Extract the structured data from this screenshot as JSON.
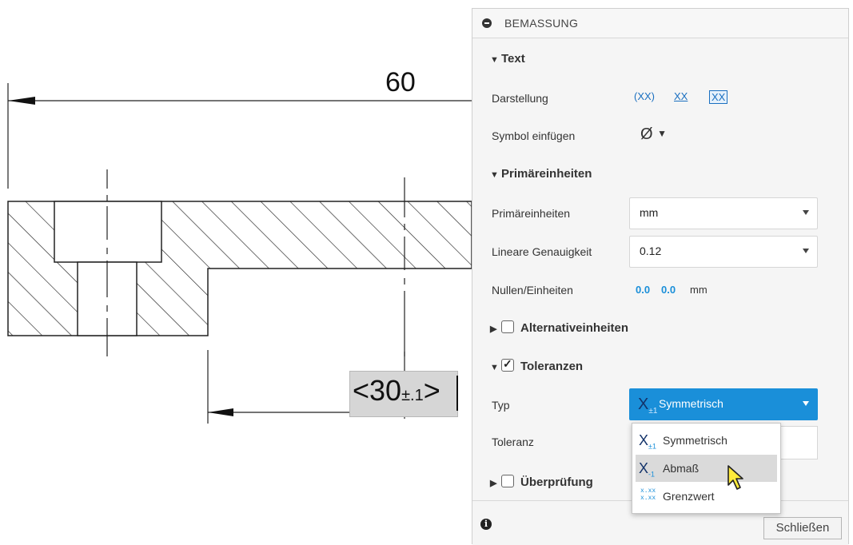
{
  "drawing": {
    "top_dimension": "60",
    "edit_dimension": {
      "prefix": "<30",
      "tolerance": "±.1",
      "suffix": ">"
    }
  },
  "panel": {
    "title": "BEMASSUNG",
    "text_section": {
      "title": "Text",
      "display_label": "Darstellung",
      "display_options": [
        "(XX)",
        "XX",
        "XX"
      ],
      "symbol_label": "Symbol einfügen",
      "symbol_value": "Ø"
    },
    "primary_section": {
      "title": "Primäreinheiten",
      "units_label": "Primäreinheiten",
      "units_value": "mm",
      "precision_label": "Lineare Genauigkeit",
      "precision_value": "0.12",
      "zeros_label": "Nullen/Einheiten",
      "zeros_options": [
        "0.0",
        "0.0",
        "mm"
      ]
    },
    "alt_section": {
      "title": "Alternativeinheiten",
      "checked": false
    },
    "tolerance_section": {
      "title": "Toleranzen",
      "checked": true,
      "type_label": "Typ",
      "type_value": "Symmetrisch",
      "tolerance_label": "Toleranz",
      "type_options": [
        "Symmetrisch",
        "Abmaß",
        "Grenzwert"
      ],
      "hovered_option": "Abmaß"
    },
    "check_section": {
      "title": "Überprüfung",
      "checked": false
    },
    "close_label": "Schließen",
    "colors": {
      "accent": "#1a8fd9",
      "panel_bg": "#f5f5f5",
      "hover": "#dadada"
    }
  }
}
